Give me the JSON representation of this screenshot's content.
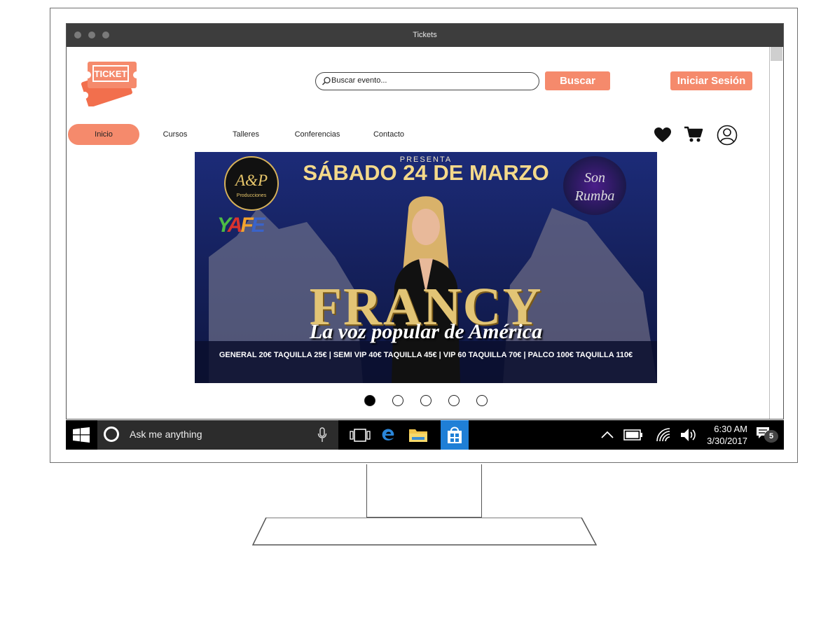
{
  "window": {
    "title": "Tickets"
  },
  "header": {
    "logo_text": "TICKET",
    "search_placeholder": "Buscar evento...",
    "search_button": "Buscar",
    "login_button": "Iniciar Sesión"
  },
  "nav": {
    "items": [
      {
        "label": "Inicio",
        "active": true
      },
      {
        "label": "Cursos"
      },
      {
        "label": "Talleres"
      },
      {
        "label": "Conferencias"
      },
      {
        "label": "Contacto"
      }
    ]
  },
  "icons": {
    "favorites": "heart-icon",
    "cart": "cart-icon",
    "account": "user-icon"
  },
  "banner": {
    "presenta": "PRESENTA",
    "date": "SÁBADO 24 DE MARZO",
    "ap_logo": "A&P",
    "ap_sub": "Producciones",
    "yafe": "YAFE",
    "son_rumba": "Son Rumba",
    "artist": "FRANCY",
    "tagline": "La voz popular de América",
    "prices": "GENERAL 20€ TAQUILLA 25€ | SEMI VIP 40€ TAQUILLA 45€ | VIP 60 TAQUILLA 70€ | PALCO 100€ TAQUILLA 110€"
  },
  "carousel": {
    "count": 5,
    "active_index": 0
  },
  "taskbar": {
    "cortana_placeholder": "Ask me anything",
    "time": "6:30 AM",
    "date": "3/30/2017",
    "notifications": "5"
  },
  "colors": {
    "accent": "#f58a6c",
    "titlebar": "#3d3d3d",
    "taskbar": "#000000",
    "store_tile": "#1f7fd6"
  }
}
